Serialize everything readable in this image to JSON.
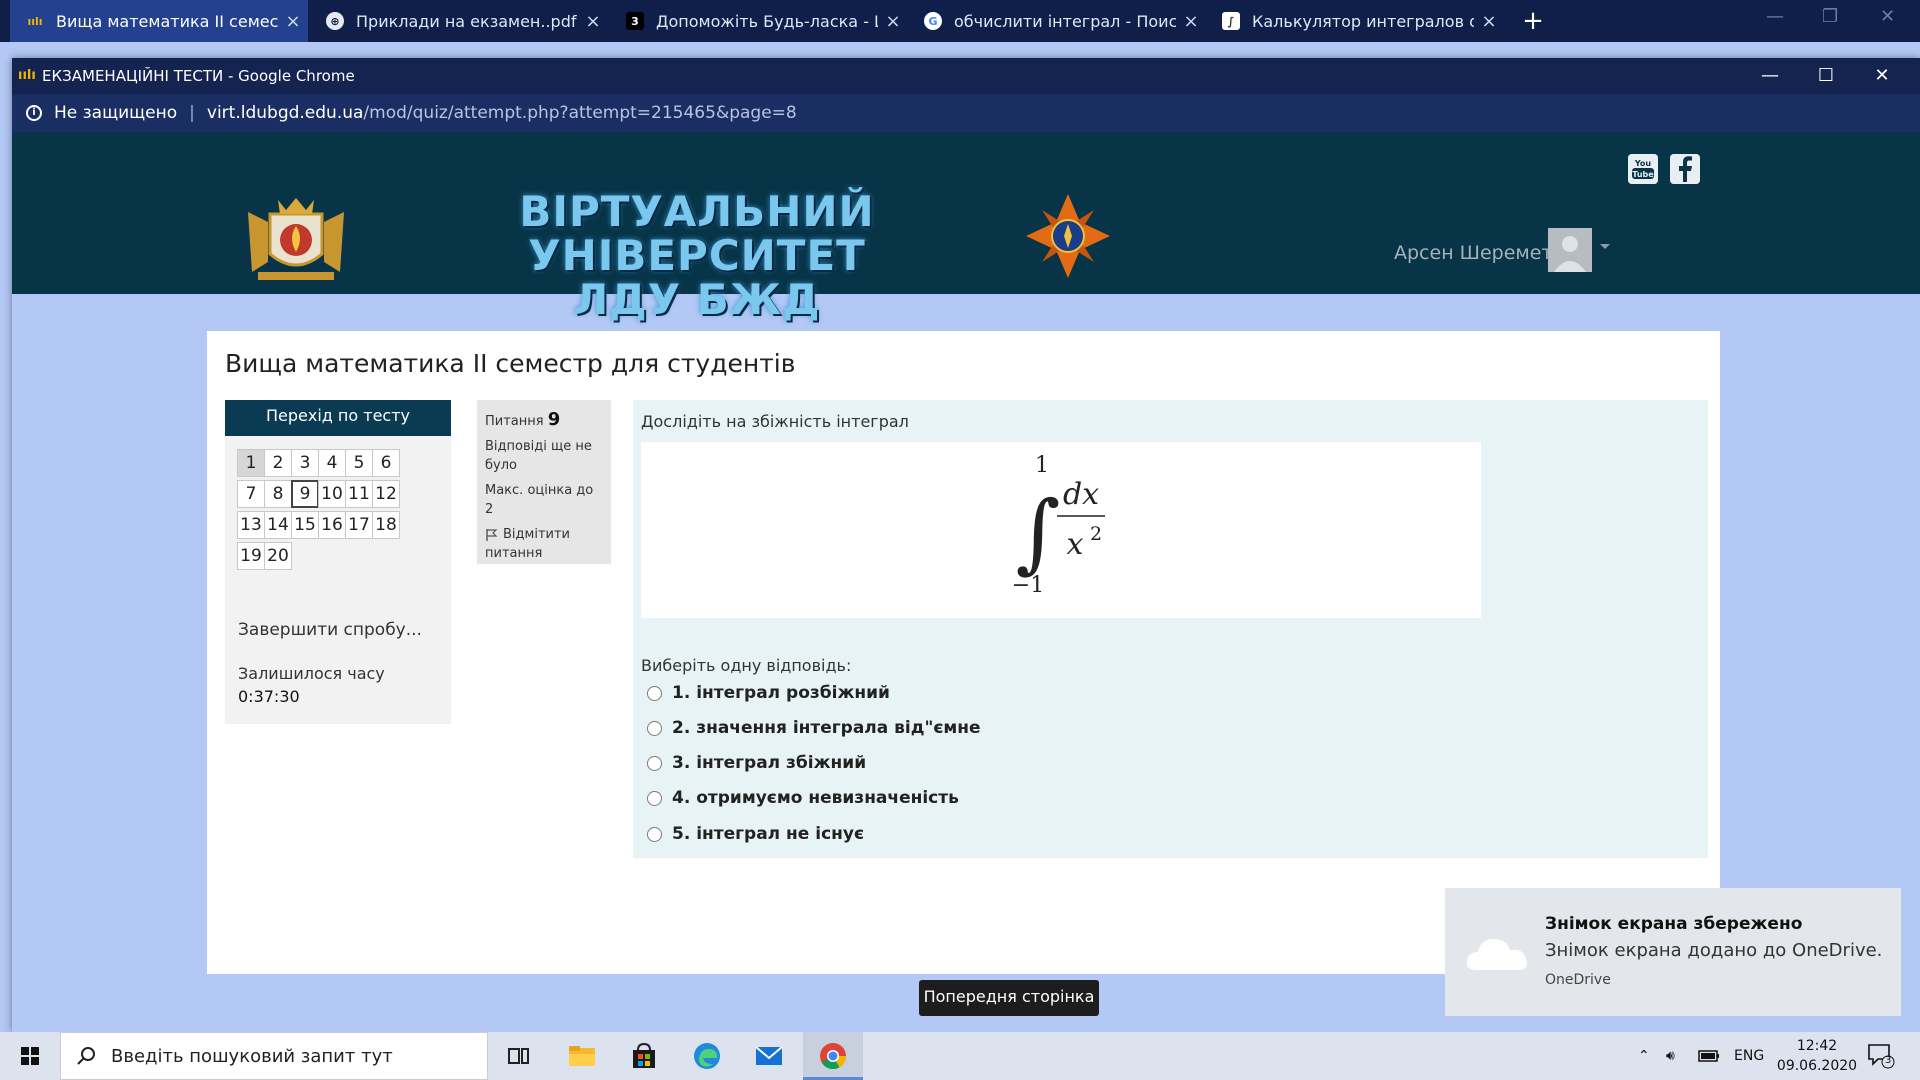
{
  "browser_tabs": [
    {
      "title": "Вища математика II семестр для",
      "active": true
    },
    {
      "title": "Приклади на екзамен..pdf",
      "active": false
    },
    {
      "title": "Допоможіть Будь-ласка - Школ",
      "active": false
    },
    {
      "title": "обчислити інтеграл - Поиск в G",
      "active": false
    },
    {
      "title": "Калькулятор интегралов онлай",
      "active": false
    }
  ],
  "window": {
    "title": "ЕКЗАМЕНАЦІЙНІ ТЕСТИ - Google Chrome",
    "security": "Не защищено",
    "domain": "virt.ldubgd.edu.ua",
    "path": "/mod/quiz/attempt.php?attempt=215465&page=8"
  },
  "header": {
    "site_title_line1": "ВІРТУАЛЬНИЙ УНІВЕРСИТЕТ",
    "site_title_line2": "ЛДУ БЖД",
    "username": "Арсен Шеремета",
    "social": [
      "YouTube",
      "Facebook"
    ]
  },
  "course": {
    "title": "Вища математика II семестр для студентів"
  },
  "quiz_nav": {
    "heading": "Перехід по тесту",
    "questions": [
      "1",
      "2",
      "3",
      "4",
      "5",
      "6",
      "7",
      "8",
      "9",
      "10",
      "11",
      "12",
      "13",
      "14",
      "15",
      "16",
      "17",
      "18",
      "19",
      "20"
    ],
    "current": "9",
    "finish_label": "Завершити спробу...",
    "time_left_label": "Залишилося часу",
    "time_left": "0:37:30"
  },
  "question": {
    "label": "Питання",
    "number": "9",
    "status": "Відповіді ще не було",
    "max_grade": "Макс. оцінка до 2",
    "flag_label": "Відмітити питання",
    "text": "Дослідіть на збіжність інтеграл",
    "formula": {
      "upper": "1",
      "lower": "−1",
      "numerator": "dx",
      "denominator": "x",
      "exponent": "2"
    },
    "prompt": "Виберіть одну відповідь:",
    "options": [
      "1. інтеграл розбіжний",
      "2. значення інтеграла від\"ємне",
      "3. інтеграл збіжний",
      "4. отримуємо невизначеність",
      "5. інтеграл  не існує"
    ]
  },
  "prev_page_button": "Попередня сторінка",
  "toast": {
    "title": "Знімок екрана збережено",
    "body": "Знімок екрана додано до OneDrive.",
    "source": "OneDrive"
  },
  "taskbar": {
    "search_placeholder": "Введіть пошуковий запит тут",
    "language": "ENG",
    "time": "12:42",
    "date": "09.06.2020",
    "notifications": "3"
  },
  "colors": {
    "page_bg": "#b3c8f5",
    "header_bg": "#073447",
    "nav_head": "#0a3b53",
    "question_bg": "#e7f3f5"
  }
}
